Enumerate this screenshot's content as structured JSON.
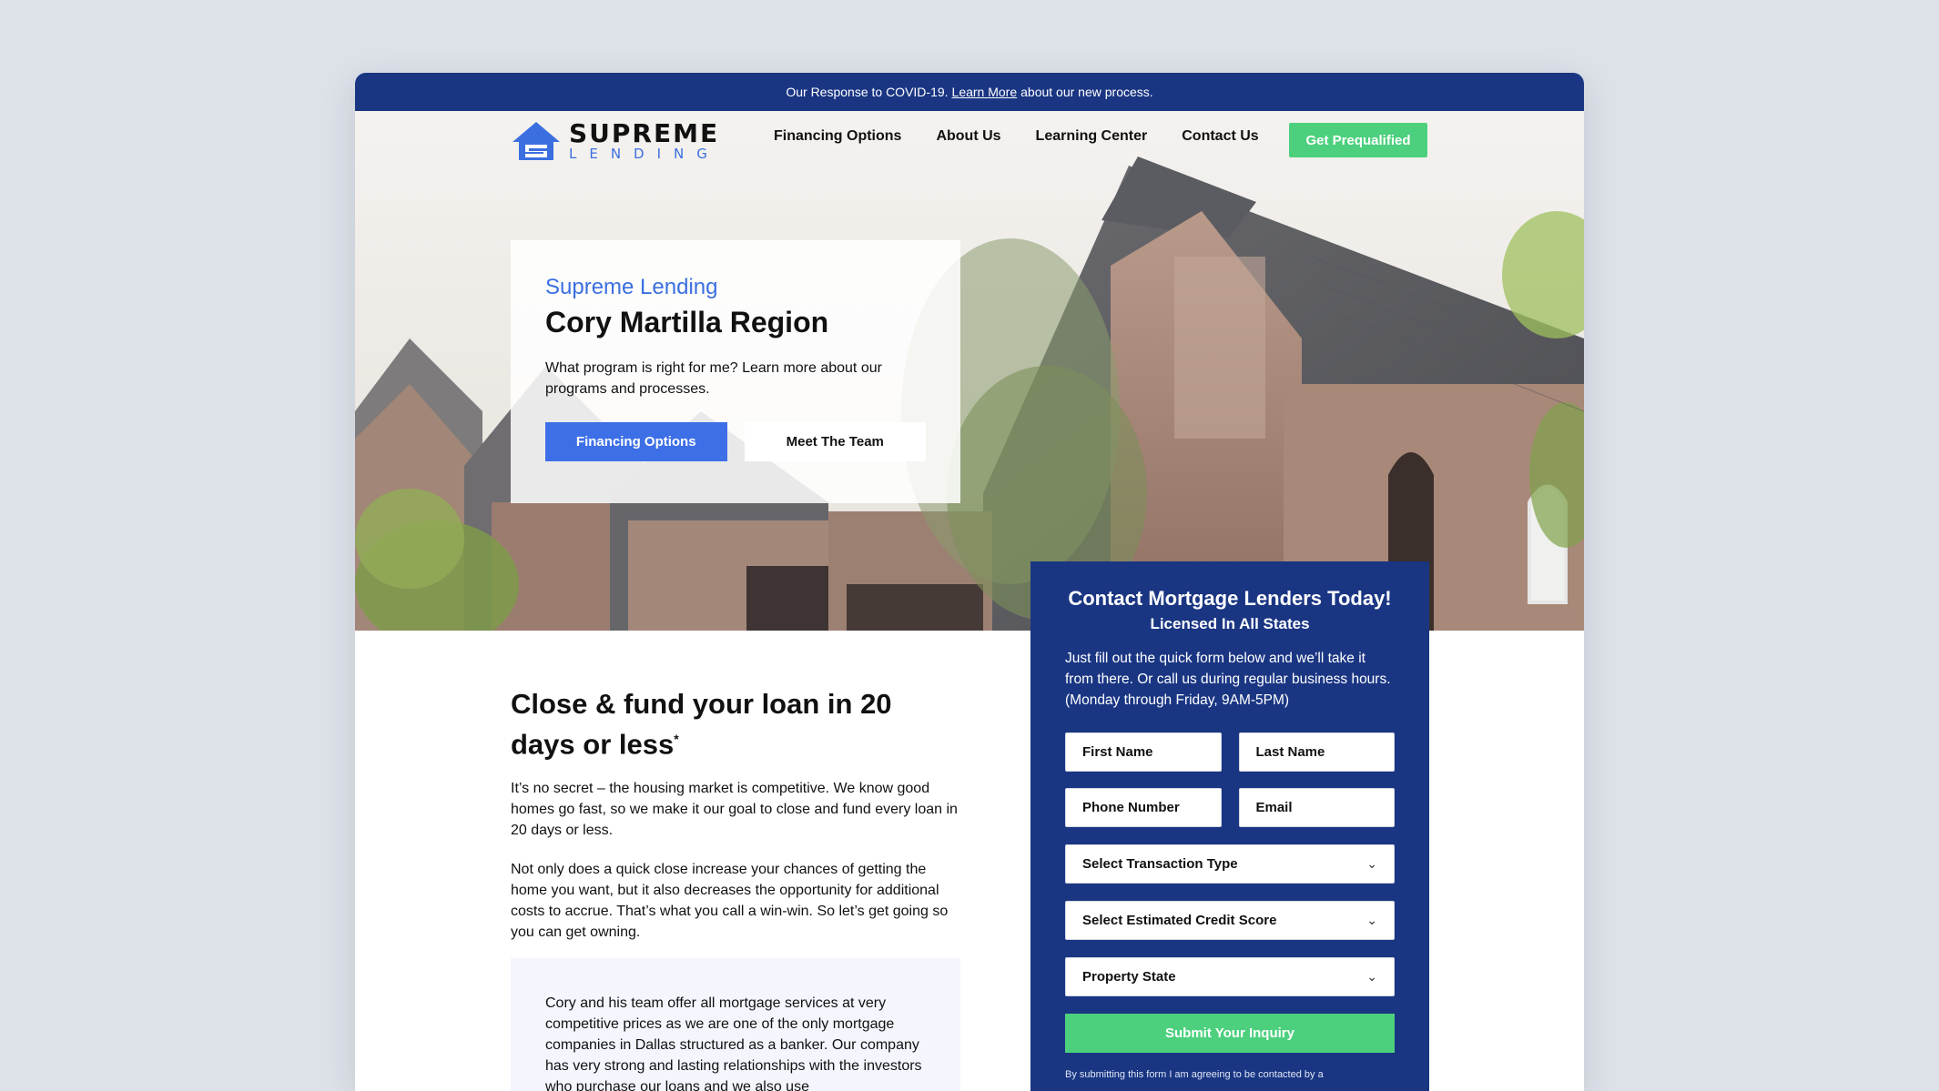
{
  "announcement": {
    "text_before": "Our Response to COVID-19.",
    "link": "Learn More",
    "text_after": "about our new process."
  },
  "logo": {
    "line1": "SUPREME",
    "line2": "LENDING",
    "icon": "house-logo-icon"
  },
  "nav": {
    "items": [
      "Financing Options",
      "About Us",
      "Learning Center",
      "Contact Us"
    ],
    "cta": "Get Prequalified"
  },
  "hero": {
    "kicker": "Supreme Lending",
    "title": "Cory Martilla Region",
    "description": "What program is right for me? Learn more about our programs and processes.",
    "primary_button": "Financing Options",
    "secondary_button": "Meet The Team"
  },
  "content": {
    "heading": "Close & fund your loan in 20 days or less",
    "heading_mark": "*",
    "paragraph1": "It’s no secret – the housing market is competitive. We know good homes go fast, so we make it our goal to close and fund every loan in 20 days or less.",
    "paragraph2": "Not only does a quick close increase your chances of getting the home you want, but it also decreases the opportunity for additional costs to accrue. That’s what you call a win-win. So let’s get going so you can get owning.",
    "quote": "Cory and his team offer all mortgage services at very competitive prices as we are one of the only mortgage companies in Dallas structured as a banker. Our company has very strong and lasting relationships with the investors who purchase our loans and we also use"
  },
  "form": {
    "title": "Contact Mortgage Lenders Today!",
    "subtitle": "Licensed In All States",
    "description": "Just fill out the quick form below and we’ll take it from there. Or call us during regular business hours. (Monday through Friday, 9AM-5PM)",
    "first_name": "First Name",
    "last_name": "Last Name",
    "phone": "Phone Number",
    "email": "Email",
    "transaction_type": "Select Transaction Type",
    "credit_score": "Select Estimated Credit Score",
    "property_state": "Property State",
    "submit": "Submit Your Inquiry",
    "disclaimer": "By submitting this form I am agreeing to be contacted by a"
  },
  "colors": {
    "navy": "#1a3683",
    "accent_blue": "#3d6fe6",
    "green": "#4cd07d",
    "page_bg": "#dde1e8"
  }
}
